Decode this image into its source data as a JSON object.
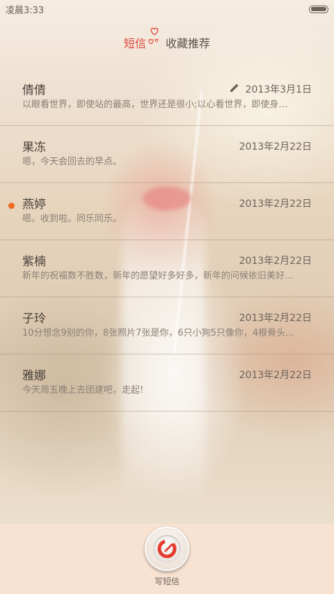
{
  "status_bar": {
    "time": "凌晨3:33"
  },
  "tabs": [
    {
      "label": "短信",
      "active": true
    },
    {
      "label": "收藏推荐",
      "active": false
    }
  ],
  "conversations": [
    {
      "name": "倩倩",
      "date": "2013年3月1日",
      "preview": "以眼看世界，即使站的最高，世界还是很小;以心看世界，即使身…",
      "unread": false,
      "draft": true
    },
    {
      "name": "果冻",
      "date": "2013年2月22日",
      "preview": "嗯，今天会回去的早点。",
      "unread": false,
      "draft": false
    },
    {
      "name": "燕婷",
      "date": "2013年2月22日",
      "preview": "嗯。收到啦。同乐同乐。",
      "unread": true,
      "draft": false
    },
    {
      "name": "紫楠",
      "date": "2013年2月22日",
      "preview": "新年的祝福数不胜数，新年的愿望好多好多，新年的问候依旧美好…",
      "unread": false,
      "draft": false
    },
    {
      "name": "子玲",
      "date": "2013年2月22日",
      "preview": "10分想念9别的你，8张照片7张是你，6只小狗5只像你，4根骨头…",
      "unread": false,
      "draft": false
    },
    {
      "name": "雅娜",
      "date": "2013年2月22日",
      "preview": "今天周五晚上去团建吧，走起!",
      "unread": false,
      "draft": false
    }
  ],
  "bottom": {
    "compose_label": "写短信"
  },
  "colors": {
    "accent": "#e0463a",
    "unread_dot": "#ef6a22",
    "compose_icon": "#e53b2e"
  },
  "icons": {
    "hearts": "hearts-icon",
    "pencil": "pencil-icon",
    "compose": "compose-icon",
    "battery": "battery-icon"
  }
}
